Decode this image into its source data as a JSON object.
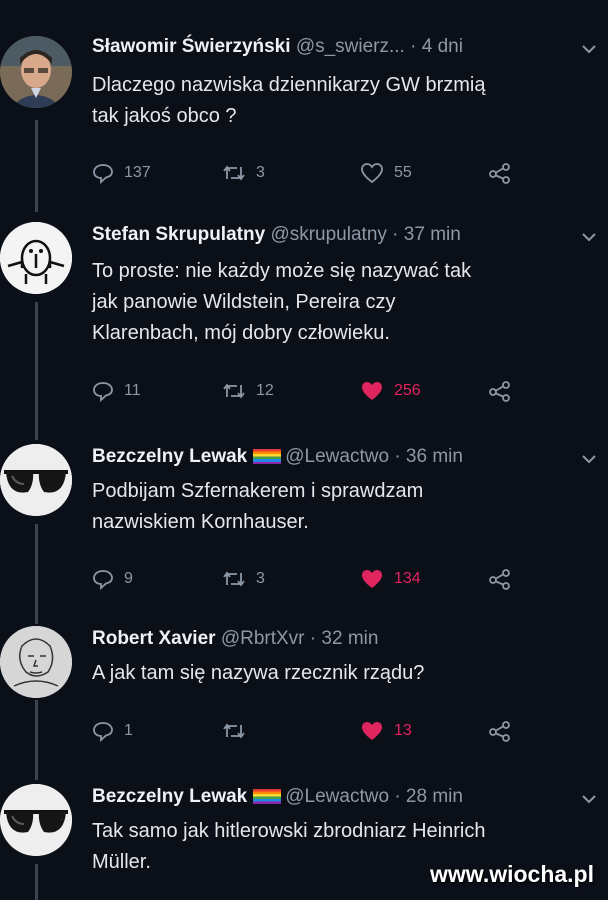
{
  "tweets": [
    {
      "name": "Sławomir Świerzyński",
      "handle": "@s_swierz...",
      "time": "· 4 dni",
      "text": "Dlaczego nazwiska dziennikarzy GW brzmią\ntak jakoś obco ?",
      "rainbow": false,
      "replies": "137",
      "retweets": "3",
      "likes": "55",
      "liked": false
    },
    {
      "name": "Stefan Skrupulatny",
      "handle": "@skrupulatny",
      "time": "· 37 min",
      "text": "To proste: nie każdy może się nazywać tak\njak panowie Wildstein, Pereira czy\nKlarenbach, mój dobry człowieku.",
      "rainbow": false,
      "replies": "11",
      "retweets": "12",
      "likes": "256",
      "liked": true
    },
    {
      "name": "Bezczelny Lewak",
      "handle": "@Lewactwo",
      "time": "· 36 min",
      "text": "Podbijam Szfernakerem i sprawdzam\nnazwiskiem Kornhauser.",
      "rainbow": true,
      "replies": "9",
      "retweets": "3",
      "likes": "134",
      "liked": true
    },
    {
      "name": "Robert Xavier",
      "handle": "@RbrtXvr",
      "time": "· 32 min",
      "text": "A jak tam się nazywa rzecznik rządu?",
      "rainbow": false,
      "replies": "1",
      "retweets": "",
      "likes": "13",
      "liked": true
    },
    {
      "name": "Bezczelny Lewak",
      "handle": "@Lewactwo",
      "time": "· 28 min",
      "text": "Tak samo jak hitlerowski zbrodniarz Heinrich\nMüller.",
      "rainbow": true,
      "replies": "",
      "retweets": "",
      "likes": "",
      "liked": false
    }
  ],
  "icons": {
    "reply": "reply-icon",
    "retweet": "retweet-icon",
    "like": "heart-icon",
    "share": "share-icon",
    "menu": "chevron-down-icon"
  },
  "colors": {
    "like_active": "#e0245e",
    "muted": "#8d98a6",
    "background": "#0b0f18"
  },
  "watermark": "www.wiocha.pl"
}
